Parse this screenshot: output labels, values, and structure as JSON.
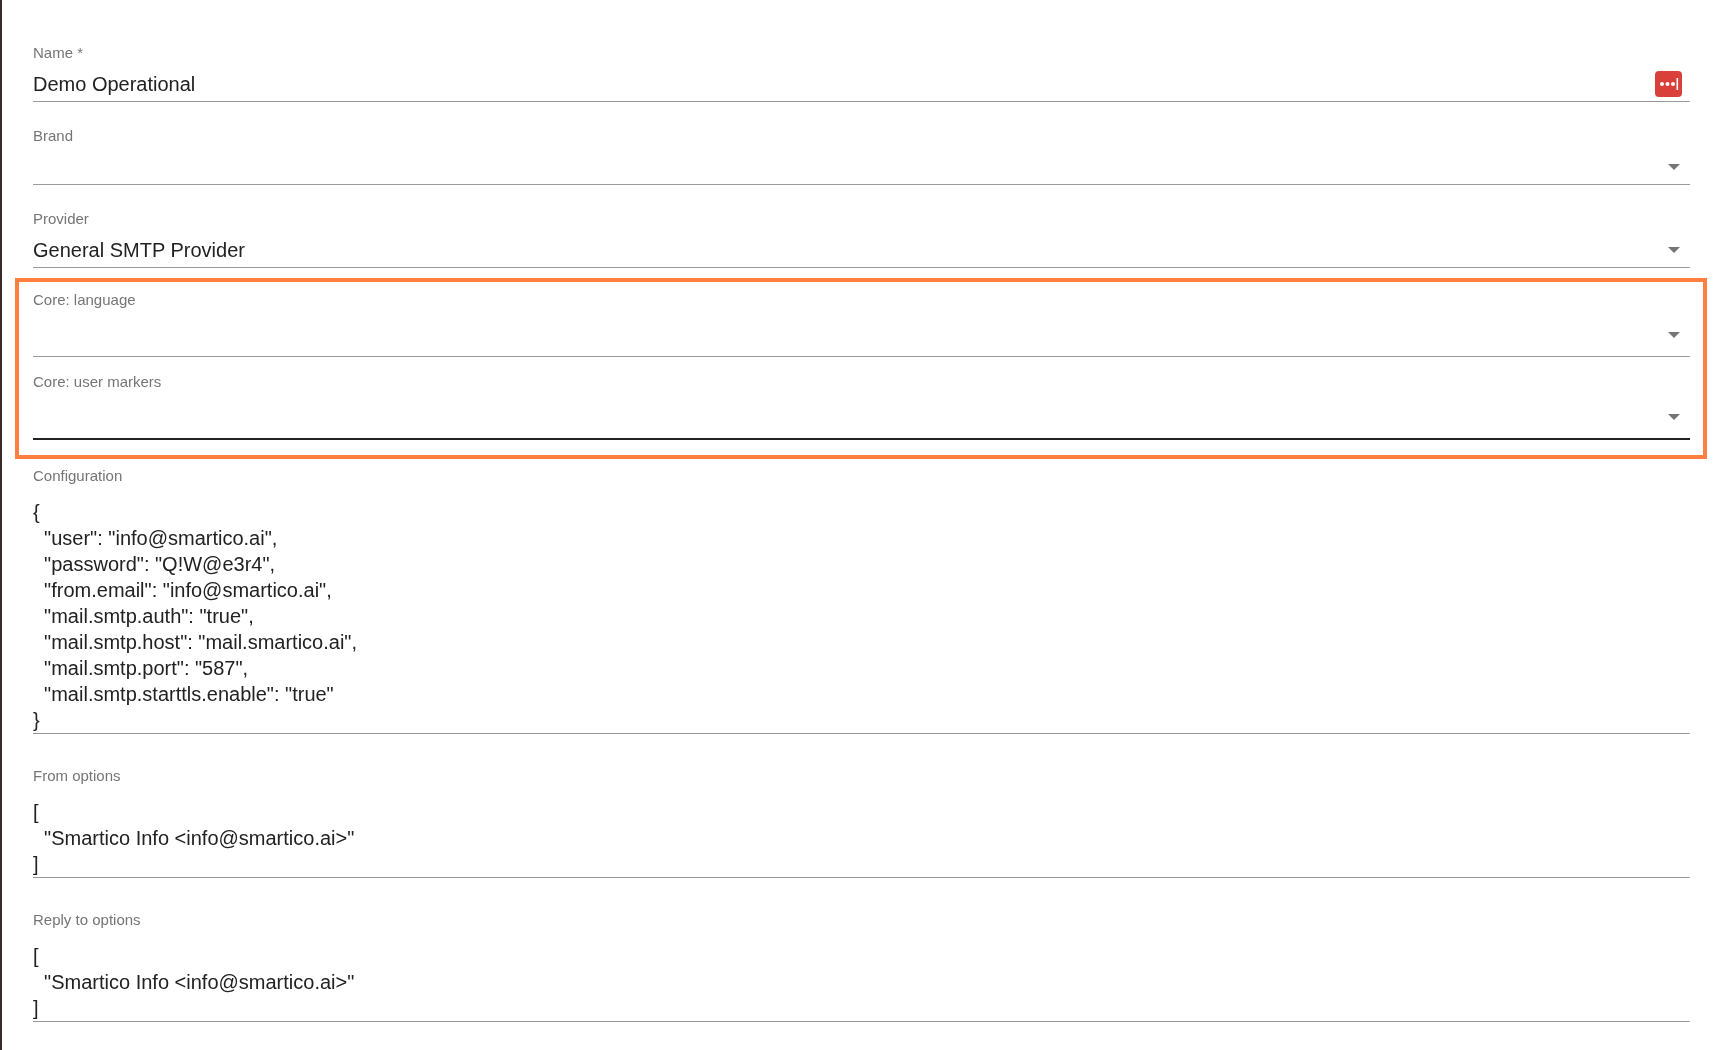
{
  "sections": [
    {
      "highlighted": false,
      "fields": [
        {
          "kind": "text",
          "label": "Name *",
          "value": "Demo Operational",
          "focused": false,
          "password_manager_icon": true
        },
        {
          "kind": "select",
          "label": "Brand",
          "focused": false
        },
        {
          "kind": "select",
          "label": "Provider",
          "value": "General SMTP Provider",
          "focused": false
        }
      ]
    },
    {
      "highlighted": true,
      "fields": [
        {
          "kind": "select",
          "label": "Core: language",
          "focused": false
        },
        {
          "kind": "select",
          "label": "Core: user markers",
          "focused": true
        }
      ]
    },
    {
      "highlighted": false,
      "fields": [
        {
          "kind": "textarea",
          "label": "Configuration",
          "value": "{\n  \"user\": \"info@smartico.ai\",\n  \"password\": \"Q!W@e3r4\",\n  \"from.email\": \"info@smartico.ai\",\n  \"mail.smtp.auth\": \"true\",\n  \"mail.smtp.host\": \"mail.smartico.ai\",\n  \"mail.smtp.port\": \"587\",\n  \"mail.smtp.starttls.enable\": \"true\"\n}",
          "focused": false
        },
        {
          "kind": "textarea",
          "label": "From options",
          "value": "[\n  \"Smartico Info <info@smartico.ai>\"\n]",
          "focused": false
        },
        {
          "kind": "textarea",
          "label": "Reply to options",
          "value": "[\n  \"Smartico Info <info@smartico.ai>\"\n]",
          "focused": false
        }
      ]
    }
  ]
}
